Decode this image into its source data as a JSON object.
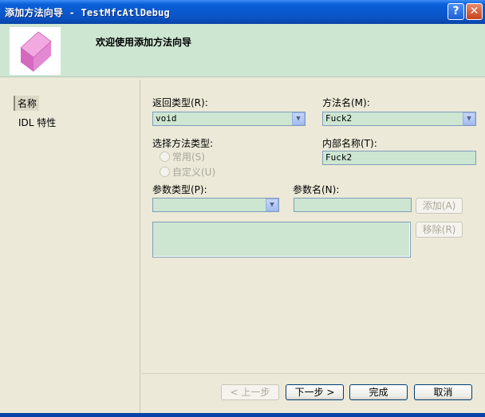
{
  "window": {
    "title": "添加方法向导 - TestMfcAtlDebug",
    "help_glyph": "?",
    "close_glyph": "✕"
  },
  "header": {
    "title": "欢迎使用添加方法向导"
  },
  "sidebar": {
    "items": [
      {
        "label": "名称",
        "selected": true
      },
      {
        "label": "IDL 特性",
        "selected": false
      }
    ]
  },
  "form": {
    "return_type": {
      "label": "返回类型(R):",
      "value": "void"
    },
    "method_name": {
      "label": "方法名(M):",
      "value": "Fuck2"
    },
    "method_type": {
      "label": "选择方法类型:",
      "options": [
        "常用(S)",
        "自定义(U)"
      ]
    },
    "internal_name": {
      "label": "内部名称(T):",
      "value": "Fuck2"
    },
    "param_type": {
      "label": "参数类型(P):",
      "value": ""
    },
    "param_name": {
      "label": "参数名(N):",
      "value": ""
    },
    "add_button": "添加(A)",
    "remove_button": "移除(R)"
  },
  "footer": {
    "back": "< 上一步",
    "next": "下一步 >",
    "finish": "完成",
    "cancel": "取消"
  },
  "colors": {
    "field_bg": "#cde6d2",
    "title_bar": "#0b55c9",
    "header_bg": "#cde6d2"
  },
  "icons": {
    "logo": "pink-cube-icon",
    "dropdown": "chevron-down-icon"
  }
}
